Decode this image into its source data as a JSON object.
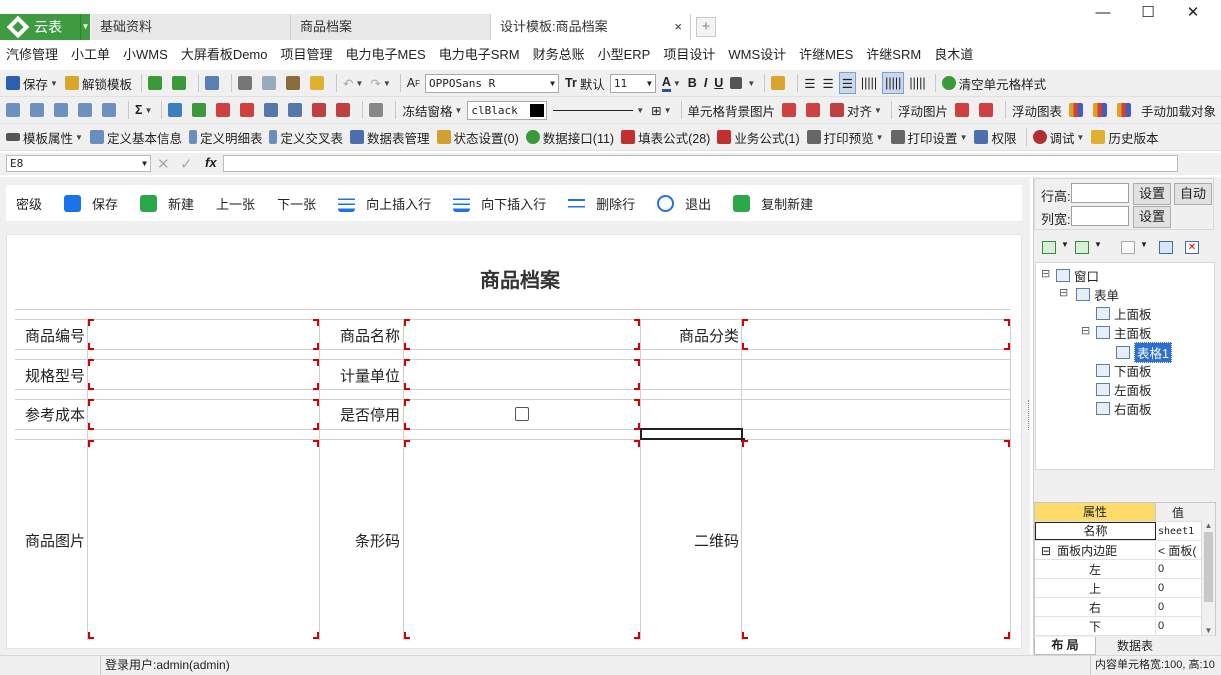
{
  "titlebar": {
    "app_tab": "云表",
    "tabs": [
      {
        "label": "基础资料",
        "active": false
      },
      {
        "label": "商品档案",
        "active": false
      },
      {
        "label": "设计模板:商品档案",
        "active": true
      }
    ],
    "close_glyph": "×",
    "add_glyph": "+",
    "window_buttons": [
      "—",
      "☐",
      "✕"
    ]
  },
  "menu": [
    "汽修管理",
    "小工单",
    "小WMS",
    "大屏看板Demo",
    "项目管理",
    "电力电子MES",
    "电力电子SRM",
    "财务总账",
    "小型ERP",
    "项目设计",
    "WMS设计",
    "许继MES",
    "许继SRM",
    "良木道"
  ],
  "toolbar1": {
    "save": "保存",
    "unlock": "解锁模板",
    "font_name": "OPPOSans R",
    "font_default": "默认",
    "font_size": "11",
    "bold": "B",
    "italic": "I",
    "underline": "U",
    "clear_style": "清空单元格样式"
  },
  "toolbar2": {
    "sigma": "Σ",
    "freeze": "冻结窗格",
    "color_value": "clBlack",
    "cell_bg_image": "单元格背景图片",
    "align": "对齐",
    "float_image": "浮动图片",
    "float_chart": "浮动图表",
    "manual_load": "手动加载对象"
  },
  "toolbar3": {
    "template_props": "模板属性",
    "define_basic": "定义基本信息",
    "define_detail": "定义明细表",
    "define_cross": "定义交叉表",
    "data_table_mgmt": "数据表管理",
    "state_settings": "状态设置(0)",
    "data_interface": "数据接口(11)",
    "fill_formula": "填表公式(28)",
    "biz_formula": "业务公式(1)",
    "print_preview": "打印预览",
    "print_settings": "打印设置",
    "permissions": "权限",
    "debug": "调试",
    "history": "历史版本"
  },
  "formula_bar": {
    "cell_ref": "E8",
    "fx": "fx",
    "value": ""
  },
  "form_toolbar": [
    "密级",
    "保存",
    "新建",
    "上一张",
    "下一张",
    "向上插入行",
    "向下插入行",
    "删除行",
    "退出",
    "复制新建"
  ],
  "form": {
    "title": "商品档案",
    "labels": {
      "code": "商品编号",
      "name": "商品名称",
      "category": "商品分类",
      "spec": "规格型号",
      "unit": "计量单位",
      "cost": "参考成本",
      "disabled": "是否停用",
      "image": "商品图片",
      "barcode": "条形码",
      "qrcode": "二维码"
    }
  },
  "right_panel": {
    "row_height_label": "行高:",
    "col_width_label": "列宽:",
    "set": "设置",
    "auto": "自动",
    "tree": [
      {
        "label": "窗口",
        "level": 0
      },
      {
        "label": "表单",
        "level": 1
      },
      {
        "label": "上面板",
        "level": 2
      },
      {
        "label": "主面板",
        "level": 2
      },
      {
        "label": "表格1",
        "level": 3,
        "selected": true
      },
      {
        "label": "下面板",
        "level": 2
      },
      {
        "label": "左面板",
        "level": 2
      },
      {
        "label": "右面板",
        "level": 2
      }
    ],
    "prop_header": "属性",
    "value_header": "值",
    "props": [
      {
        "name": "名称",
        "value": "sheet1"
      },
      {
        "name": "面板内边距",
        "value": "< 面板("
      },
      {
        "name": "左",
        "value": "0"
      },
      {
        "name": "上",
        "value": "0"
      },
      {
        "name": "右",
        "value": "0"
      },
      {
        "name": "下",
        "value": "0"
      }
    ],
    "bottom_tabs": [
      "布 局",
      "数据表"
    ]
  },
  "status": {
    "user": "登录用户:admin(admin)",
    "cell_info": "内容单元格宽:100, 高:10"
  },
  "colors": {
    "brand_green": "#3f9b3f",
    "selected_prop": "#fddc6b",
    "tree_selected": "#2e6fd0",
    "red_mark": "#d40000"
  }
}
